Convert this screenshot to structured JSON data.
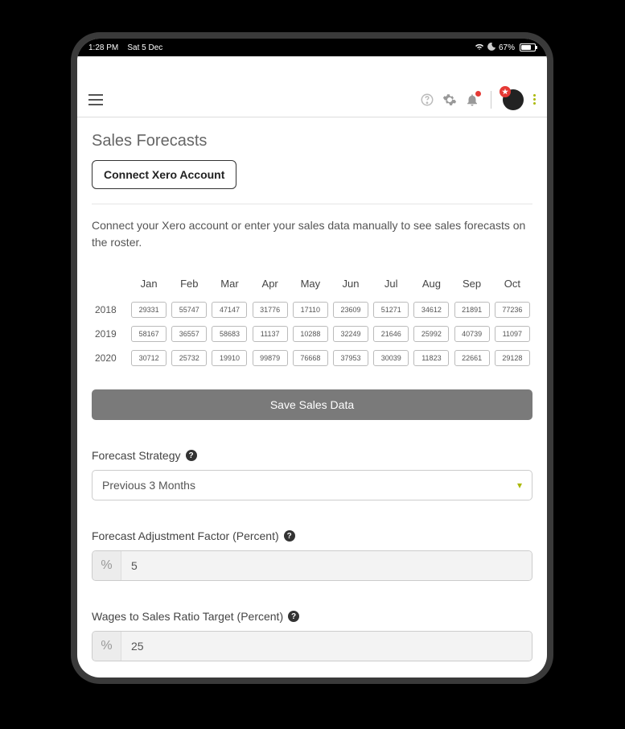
{
  "status": {
    "time": "1:28 PM",
    "date": "Sat 5 Dec",
    "battery_pct": "67%"
  },
  "page": {
    "title": "Sales Forecasts",
    "connect_label": "Connect Xero Account",
    "description": "Connect your Xero account or enter your sales data manually to see sales forecasts on the roster.",
    "save_label": "Save Sales Data"
  },
  "table": {
    "months": [
      "Jan",
      "Feb",
      "Mar",
      "Apr",
      "May",
      "Jun",
      "Jul",
      "Aug",
      "Sep",
      "Oct"
    ],
    "rows": [
      {
        "year": "2018",
        "values": [
          "29331",
          "55747",
          "47147",
          "31776",
          "17110",
          "23609",
          "51271",
          "34612",
          "21891",
          "77236"
        ]
      },
      {
        "year": "2019",
        "values": [
          "58167",
          "36557",
          "58683",
          "11137",
          "10288",
          "32249",
          "21646",
          "25992",
          "40739",
          "11097"
        ]
      },
      {
        "year": "2020",
        "values": [
          "30712",
          "25732",
          "19910",
          "99879",
          "76668",
          "37953",
          "30039",
          "11823",
          "22661",
          "29128"
        ]
      }
    ]
  },
  "forecast_strategy": {
    "label": "Forecast Strategy",
    "value": "Previous 3 Months"
  },
  "adjustment": {
    "label": "Forecast Adjustment Factor (Percent)",
    "value": "5"
  },
  "wages_ratio": {
    "label": "Wages to Sales Ratio Target (Percent)",
    "value": "25"
  }
}
